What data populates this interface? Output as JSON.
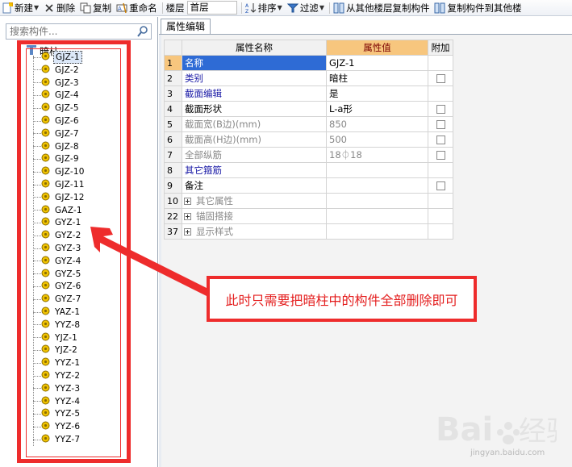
{
  "toolbar": {
    "new_label": "新建",
    "delete_label": "删除",
    "copy_label": "复制",
    "rename_label": "重命名",
    "floor_label": "楼层",
    "floor_value": "首层",
    "sort_label": "排序",
    "filter_label": "过滤",
    "copy_from_floor_label": "从其他楼层复制构件",
    "copy_to_floor_label": "复制构件到其他楼"
  },
  "left": {
    "search_placeholder": "搜索构件...",
    "root_label": "暗柱",
    "items": [
      "GJZ-1",
      "GJZ-2",
      "GJZ-3",
      "GJZ-4",
      "GJZ-5",
      "GJZ-6",
      "GJZ-7",
      "GJZ-8",
      "GJZ-9",
      "GJZ-10",
      "GJZ-11",
      "GJZ-12",
      "GAZ-1",
      "GYZ-1",
      "GYZ-2",
      "GYZ-3",
      "GYZ-4",
      "GYZ-5",
      "GYZ-6",
      "GYZ-7",
      "YAZ-1",
      "YYZ-8",
      "YJZ-1",
      "YJZ-2",
      "YYZ-1",
      "YYZ-2",
      "YYZ-3",
      "YYZ-4",
      "YYZ-5",
      "YYZ-6",
      "YYZ-7"
    ]
  },
  "right": {
    "tab_label": "属性编辑",
    "headers": {
      "name": "属性名称",
      "value": "属性值",
      "attach": "附加"
    },
    "rows": [
      {
        "num": "1",
        "name": "名称",
        "value": "GJZ-1"
      },
      {
        "num": "2",
        "name": "类别",
        "value": "暗柱"
      },
      {
        "num": "3",
        "name": "截面编辑",
        "value": "是"
      },
      {
        "num": "4",
        "name": "截面形状",
        "value": "L-a形"
      },
      {
        "num": "5",
        "name": "截面宽(B边)(mm)",
        "value": "850"
      },
      {
        "num": "6",
        "name": "截面高(H边)(mm)",
        "value": "500"
      },
      {
        "num": "7",
        "name": "全部纵筋",
        "value": "18⏀18"
      },
      {
        "num": "8",
        "name": "其它箍筋",
        "value": ""
      },
      {
        "num": "9",
        "name": "备注",
        "value": ""
      },
      {
        "num": "10",
        "name": "其它属性",
        "value": ""
      },
      {
        "num": "22",
        "name": "锚固搭接",
        "value": ""
      },
      {
        "num": "37",
        "name": "显示样式",
        "value": ""
      }
    ]
  },
  "annotation": {
    "text": "此时只需要把暗柱中的构件全部删除即可"
  },
  "watermark": {
    "sub": "jingyan.baidu.com"
  },
  "colors": {
    "annotation_red": "#ee2c2c",
    "header_value_bg": "#f7c67e",
    "selected_blue": "#2e6bd5"
  }
}
